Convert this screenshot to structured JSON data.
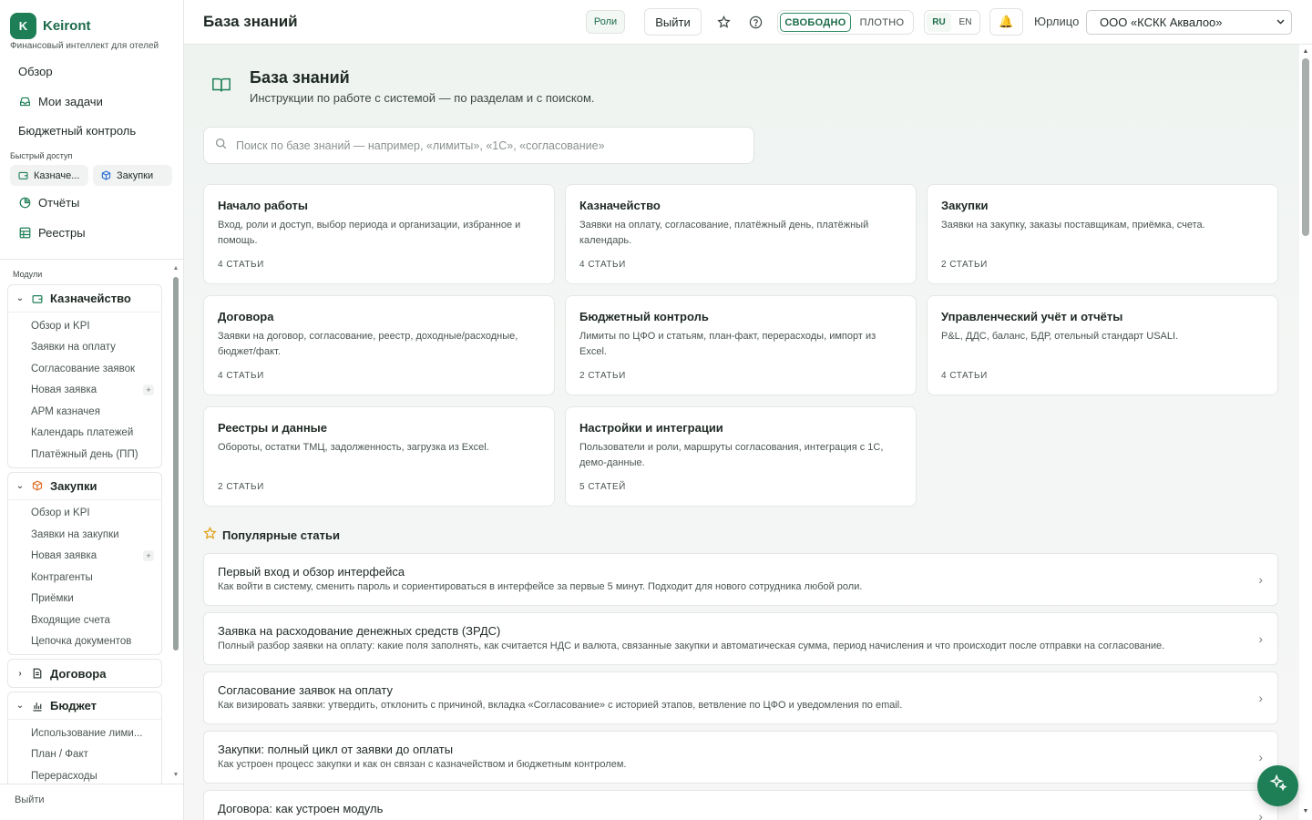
{
  "brand": {
    "logo_letter": "K",
    "name": "Keiront",
    "subtitle": "Финансовый интеллект для отелей"
  },
  "nav": {
    "overview": "Обзор",
    "my_tasks": "Мои задачи",
    "budget_control": "Бюджетный контроль",
    "quick_access_label": "Быстрый доступ",
    "quick": [
      "Казначе...",
      "Закупки"
    ],
    "reports": "Отчёты",
    "registries": "Реестры"
  },
  "modules": {
    "label": "Модули",
    "groups": [
      {
        "title": "Казначейство",
        "items": [
          "Обзор и KPI",
          "Заявки на оплату",
          "Согласование заявок",
          "Новая заявка",
          "АРМ казначея",
          "Календарь платежей",
          "Платёжный день (ПП)"
        ]
      },
      {
        "title": "Закупки",
        "items": [
          "Обзор и KPI",
          "Заявки на закупки",
          "Новая заявка",
          "Контрагенты",
          "Приёмки",
          "Входящие счета",
          "Цепочка документов"
        ]
      },
      {
        "title": "Договора",
        "items": []
      },
      {
        "title": "Бюджет",
        "items": [
          "Использование лими...",
          "План / Факт",
          "Перерасходы"
        ]
      }
    ],
    "plus": "+"
  },
  "sidebar_logout": "Выйти",
  "topbar": {
    "title": "База знаний",
    "roles": "Роли",
    "exit": "Выйти",
    "density_free": "СВОБОДНО",
    "density_dense": "ПЛОТНО",
    "lang_ru": "RU",
    "lang_en": "EN",
    "bell": "🔔",
    "entity_label": "Юрлицо",
    "entity_value": "ООО «КСКК Аквалоо»"
  },
  "kb": {
    "title": "База знаний",
    "subtitle": "Инструкции по работе с системой — по разделам и с поиском.",
    "search_placeholder": "Поиск по базе знаний — например, «лимиты», «1С», «согласование»",
    "cards": [
      {
        "title": "Начало работы",
        "desc": "Вход, роли и доступ, выбор периода и организации, избранное и помощь.",
        "count": "4 СТАТЬИ"
      },
      {
        "title": "Казначейство",
        "desc": "Заявки на оплату, согласование, платёжный день, платёжный календарь.",
        "count": "4 СТАТЬИ"
      },
      {
        "title": "Закупки",
        "desc": "Заявки на закупку, заказы поставщикам, приёмка, счета.",
        "count": "2 СТАТЬИ"
      },
      {
        "title": "Договора",
        "desc": "Заявки на договор, согласование, реестр, доходные/расходные, бюджет/факт.",
        "count": "4 СТАТЬИ"
      },
      {
        "title": "Бюджетный контроль",
        "desc": "Лимиты по ЦФО и статьям, план-факт, перерасходы, импорт из Excel.",
        "count": "2 СТАТЬИ"
      },
      {
        "title": "Управленческий учёт и отчёты",
        "desc": "P&L, ДДС, баланс, БДР, отельный стандарт USALI.",
        "count": "4 СТАТЬИ"
      },
      {
        "title": "Реестры и данные",
        "desc": "Обороты, остатки ТМЦ, задолженность, загрузка из Excel.",
        "count": "2 СТАТЬИ"
      },
      {
        "title": "Настройки и интеграции",
        "desc": "Пользователи и роли, маршруты согласования, интеграция с 1С, демо-данные.",
        "count": "5 СТАТЕЙ"
      }
    ],
    "popular_title": "Популярные статьи",
    "articles": [
      {
        "title": "Первый вход и обзор интерфейса",
        "desc": "Как войти в систему, сменить пароль и сориентироваться в интерфейсе за первые 5 минут. Подходит для нового сотрудника любой роли."
      },
      {
        "title": "Заявка на расходование денежных средств (ЗРДС)",
        "desc": "Полный разбор заявки на оплату: какие поля заполнять, как считается НДС и валюта, связанные закупки и автоматическая сумма, период начисления и что происходит после отправки на согласование."
      },
      {
        "title": "Согласование заявок на оплату",
        "desc": "Как визировать заявки: утвердить, отклонить с причиной, вкладка «Согласование» с историей этапов, ветвление по ЦФО и уведомления по email."
      },
      {
        "title": "Закупки: полный цикл от заявки до оплаты",
        "desc": "Как устроен процесс закупки и как он связан с казначейством и бюджетным контролем."
      },
      {
        "title": "Договора: как устроен модуль",
        "desc": ""
      }
    ]
  },
  "colors": {
    "accent": "#1e7f57",
    "accent_dark": "#1b6b4a",
    "bell": "#e0a21b"
  }
}
